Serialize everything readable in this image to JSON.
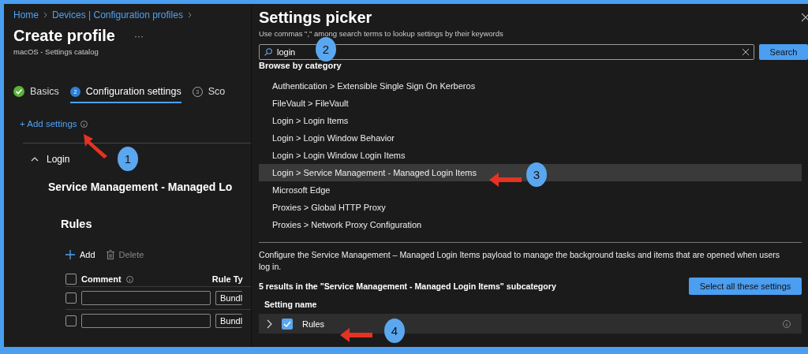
{
  "breadcrumb": [
    {
      "label": "Home"
    },
    {
      "label": "Devices | Configuration profiles"
    }
  ],
  "page": {
    "title": "Create profile",
    "more": "···",
    "subtitle": "macOS - Settings catalog"
  },
  "tabs": [
    {
      "label": "Basics",
      "kind": "done",
      "selected": false
    },
    {
      "label": "Configuration settings",
      "step": "2",
      "kind": "current",
      "selected": true
    },
    {
      "label": "Sco",
      "step": "3",
      "kind": "pending",
      "selected": false
    }
  ],
  "add_settings": "+ Add settings",
  "group": {
    "label": "Login",
    "expanded": true
  },
  "setting_heading": "Service Management - Managed Lo",
  "rules": {
    "title": "Rules",
    "add": "Add",
    "delete": "Delete",
    "delete_disabled": true,
    "columns": [
      "Comment",
      "Rule Ty"
    ],
    "header_checked": false,
    "rows": [
      {
        "checked": false,
        "comment": "",
        "rule_type": "Bundl"
      },
      {
        "checked": false,
        "comment": "",
        "rule_type": "Bundl"
      }
    ]
  },
  "picker": {
    "title": "Settings picker",
    "hint": "Use commas \",\" among search terms to lookup settings by their keywords",
    "search_value": "login",
    "search_button": "Search",
    "browse_label": "Browse by category",
    "categories": [
      {
        "label": "Authentication > Extensible Single Sign On Kerberos",
        "selected": false
      },
      {
        "label": "FileVault > FileVault",
        "selected": false
      },
      {
        "label": "Login > Login Items",
        "selected": false
      },
      {
        "label": "Login > Login Window Behavior",
        "selected": false
      },
      {
        "label": "Login > Login Window Login Items",
        "selected": false
      },
      {
        "label": "Login > Service Management - Managed Login Items",
        "selected": true
      },
      {
        "label": "Microsoft Edge",
        "selected": false
      },
      {
        "label": "Proxies > Global HTTP Proxy",
        "selected": false
      },
      {
        "label": "Proxies > Network Proxy Configuration",
        "selected": false
      }
    ],
    "description": "Configure the Service Management – Managed Login Items payload to manage the background tasks and items that are opened when users log in.",
    "results": "5 results in the \"Service Management - Managed Login Items\" subcategory",
    "select_all": "Select all these settings",
    "column": "Setting name",
    "settings": [
      {
        "label": "Rules",
        "checked": true,
        "expanded": false
      }
    ]
  },
  "callouts": [
    {
      "number": "1",
      "arrow": true
    },
    {
      "number": "2",
      "arrow": false
    },
    {
      "number": "3",
      "arrow": true
    },
    {
      "number": "4",
      "arrow": true
    }
  ]
}
